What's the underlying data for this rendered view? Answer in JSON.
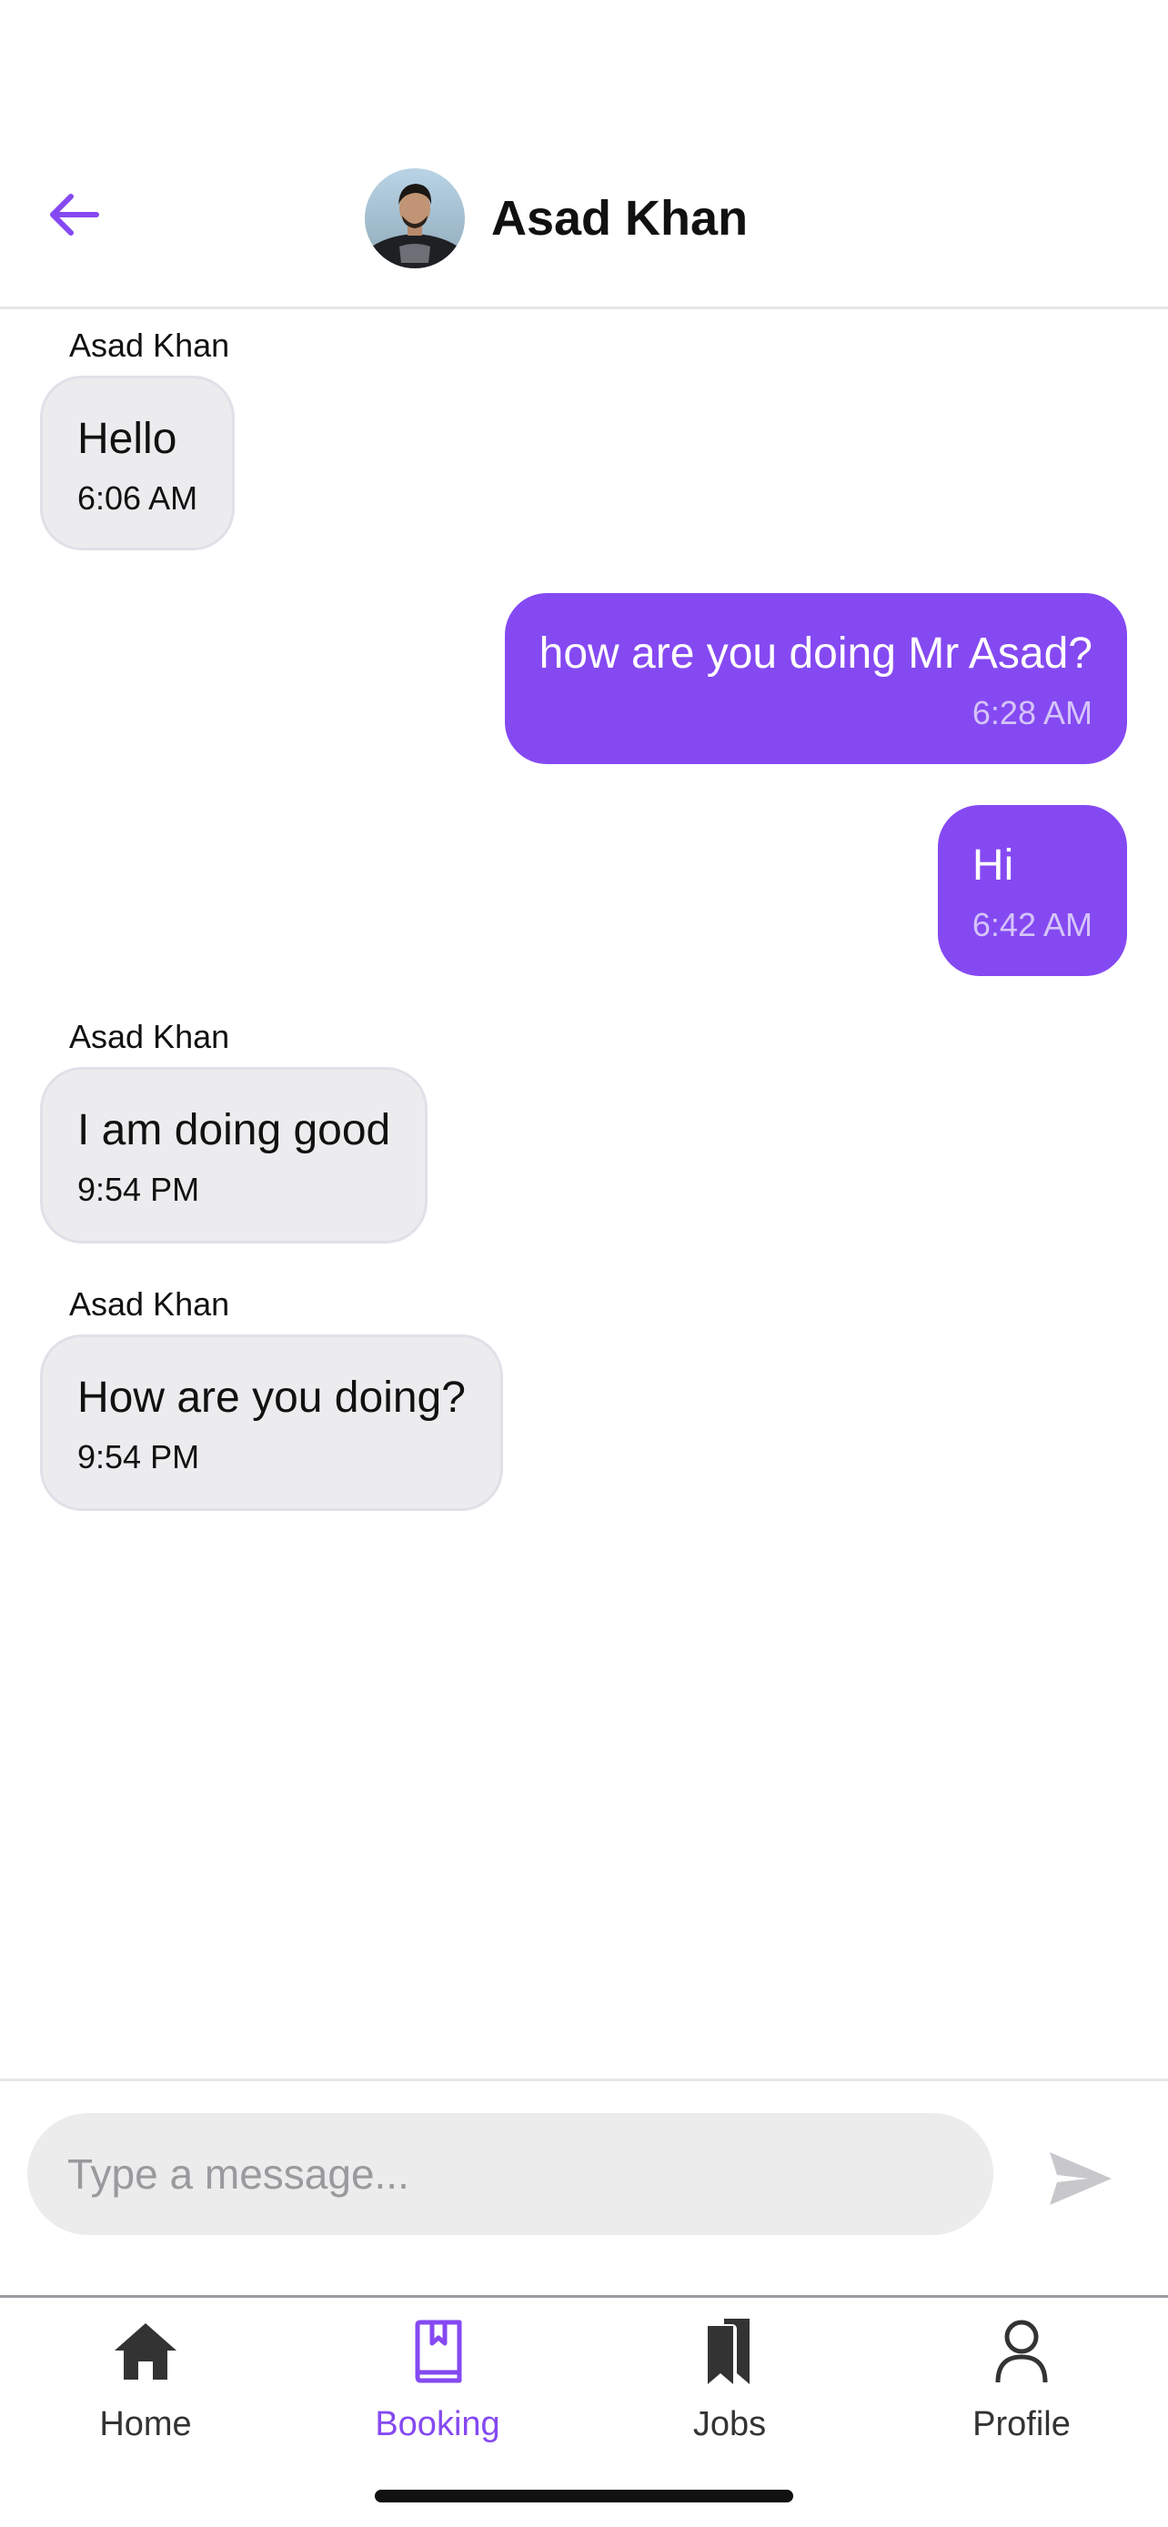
{
  "colors": {
    "accent": "#8549f2",
    "incoming_bubble": "#ececee",
    "outgoing_time": "#d5c4fa",
    "nav_inactive": "#333333",
    "send_icon": "#c8c8cc"
  },
  "header": {
    "back_icon": "arrow-left-icon",
    "avatar": "contact-avatar-photo",
    "contact_name": "Asad Khan"
  },
  "messages": [
    {
      "direction": "incoming",
      "sender": "Asad Khan",
      "text": "Hello",
      "time": "6:06 AM"
    },
    {
      "direction": "outgoing",
      "text": "how are you doing Mr Asad?",
      "time": "6:28 AM"
    },
    {
      "direction": "outgoing",
      "text": "Hi",
      "time": "6:42 AM"
    },
    {
      "direction": "incoming",
      "sender": "Asad Khan",
      "text": "I am doing good",
      "time": "9:54 PM"
    },
    {
      "direction": "incoming",
      "sender": "Asad Khan",
      "text": "How are you doing?",
      "time": "9:54 PM"
    }
  ],
  "composer": {
    "placeholder": "Type a message...",
    "value": "",
    "send_icon": "send-icon"
  },
  "nav": {
    "active": "Booking",
    "items": [
      {
        "label": "Home",
        "icon": "home-icon"
      },
      {
        "label": "Booking",
        "icon": "book-icon"
      },
      {
        "label": "Jobs",
        "icon": "bookmarks-icon"
      },
      {
        "label": "Profile",
        "icon": "person-icon"
      }
    ]
  }
}
